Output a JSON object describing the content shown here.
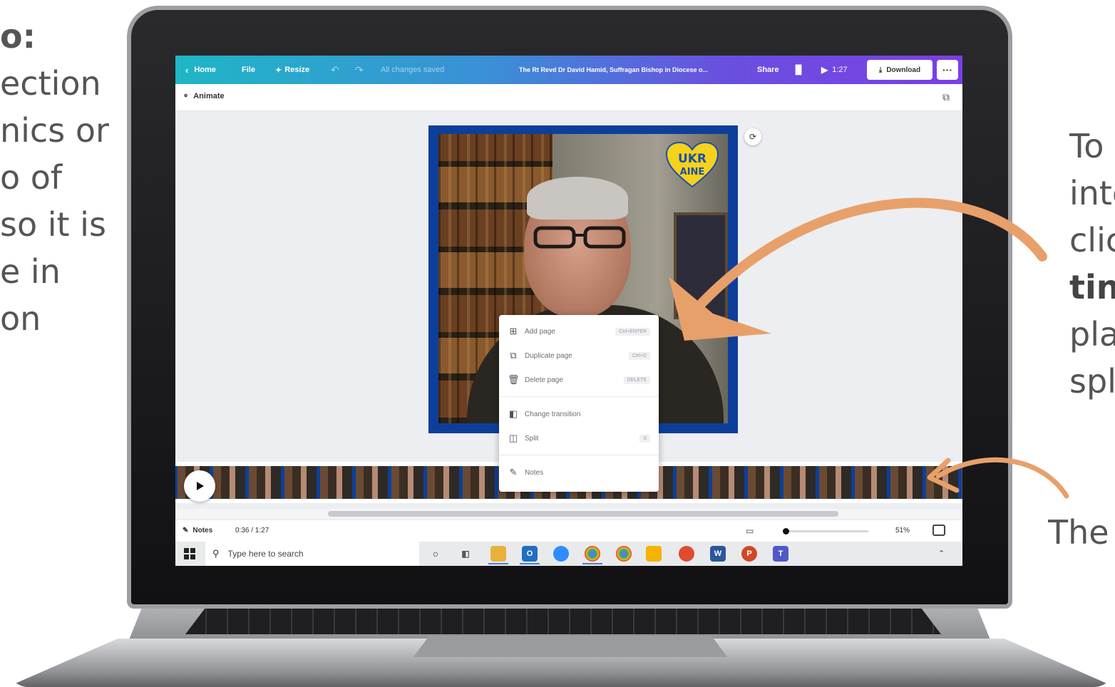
{
  "left_text": {
    "lines": [
      "o:",
      "ection",
      "nics or",
      "o of",
      "so it is",
      "e in",
      "on"
    ]
  },
  "right_text": {
    "lines": [
      "To",
      "inte",
      "clic",
      "tin",
      "pla",
      "spl"
    ]
  },
  "bottom_right_text": "The",
  "canva": {
    "topbar": {
      "home": "Home",
      "file": "File",
      "resize": "Resize",
      "status": "All changes saved",
      "title": "The Rt Revd Dr David Hamid, Suffragan Bishop in Diocese o...",
      "share": "Share",
      "play_time": "1:27",
      "download": "Download",
      "more": "···"
    },
    "toolbar": {
      "animate": "Animate"
    },
    "badge_text": "UKRAINE",
    "context_menu": {
      "items": [
        {
          "label": "Add page",
          "shortcut": "Ctrl+ENTER"
        },
        {
          "label": "Duplicate page",
          "shortcut": "Ctrl+D"
        },
        {
          "label": "Delete page",
          "shortcut": "DELETE"
        },
        {
          "label": "Change transition",
          "shortcut": ""
        },
        {
          "label": "Split",
          "shortcut": "S"
        },
        {
          "label": "Notes",
          "shortcut": ""
        }
      ]
    },
    "footer": {
      "notes": "Notes",
      "time": "0:36 / 1:27",
      "zoom": "51%",
      "zoom_level": 0.51
    },
    "taskbar": {
      "search_placeholder": "Type here to search"
    }
  },
  "colors": {
    "arrow": "#e8a06a",
    "frame_blue": "#0d3f9a",
    "topbar_start": "#1fb6c6",
    "topbar_end": "#7b3fe4"
  }
}
